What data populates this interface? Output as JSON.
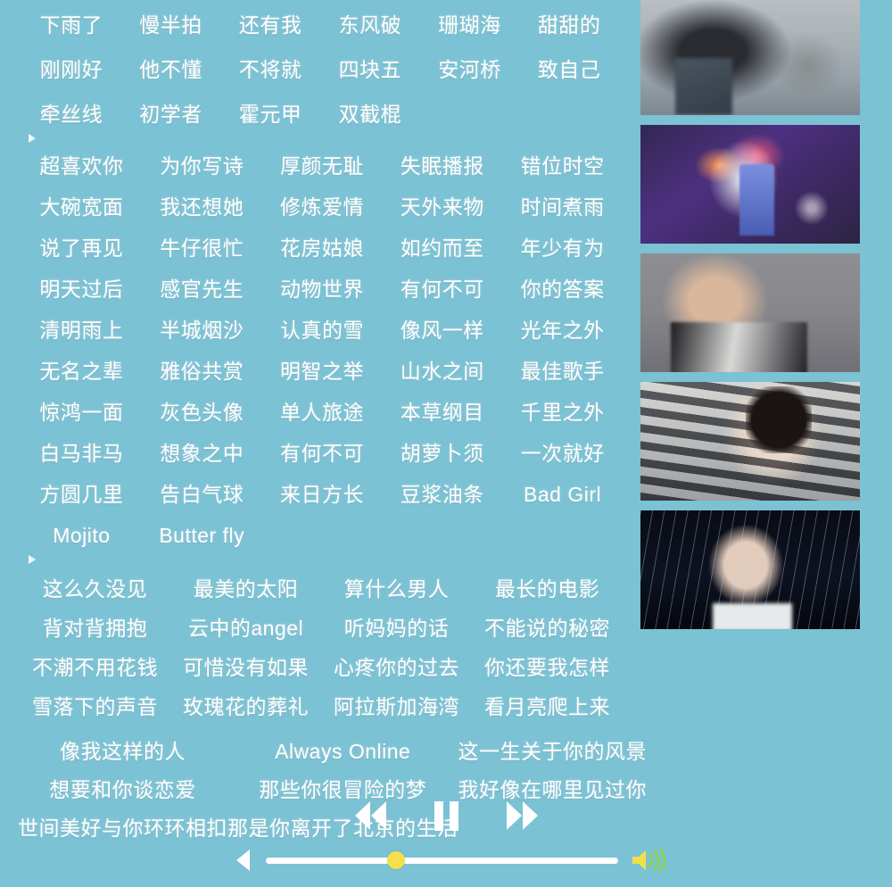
{
  "theme": {
    "background": "#7ac2d4",
    "text": "#ffffff",
    "knob": "#f5e04b",
    "volume_icon": "#f2e04a",
    "volume_waves": "#8fd44a"
  },
  "sections": [
    {
      "id": "section-1",
      "columns": 6,
      "has_marker_after": true,
      "songs": [
        "下雨了",
        "慢半拍",
        "还有我",
        "东风破",
        "珊瑚海",
        "甜甜的",
        "刚刚好",
        "他不懂",
        "不将就",
        "四块五",
        "安河桥",
        "致自己",
        "牵丝线",
        "初学者",
        "霍元甲",
        "双截棍",
        "",
        ""
      ]
    },
    {
      "id": "section-2",
      "columns": 5,
      "has_marker_after": true,
      "songs": [
        "超喜欢你",
        "为你写诗",
        "厚颜无耻",
        "失眠播报",
        "错位时空",
        "大碗宽面",
        "我还想她",
        "修炼爱情",
        "天外来物",
        "时间煮雨",
        "说了再见",
        "牛仔很忙",
        "花房姑娘",
        "如约而至",
        "年少有为",
        "明天过后",
        "感官先生",
        "动物世界",
        "有何不可",
        "你的答案",
        "清明雨上",
        "半城烟沙",
        "认真的雪",
        "像风一样",
        "光年之外",
        "无名之辈",
        "雅俗共赏",
        "明智之举",
        "山水之间",
        "最佳歌手",
        "惊鸿一面",
        "灰色头像",
        "单人旅途",
        "本草纲目",
        "千里之外",
        "白马非马",
        "想象之中",
        "有何不可",
        "胡萝卜须",
        "一次就好",
        "方圆几里",
        "告白气球",
        "来日方长",
        "豆浆油条",
        "Bad Girl",
        "Mojito",
        "Butter fly",
        "",
        "",
        ""
      ]
    },
    {
      "id": "section-3",
      "columns": 4,
      "has_marker_after": false,
      "songs": [
        "这么久没见",
        "最美的太阳",
        "算什么男人",
        "最长的电影",
        "背对背拥抱",
        "云中的angel",
        "听妈妈的话",
        "不能说的秘密",
        "不潮不用花钱",
        "可惜没有如果",
        "心疼你的过去",
        "你还要我怎样",
        "雪落下的声音",
        "玫瑰花的葬礼",
        "阿拉斯加海湾",
        "看月亮爬上来"
      ]
    },
    {
      "id": "section-4",
      "columns": 3,
      "has_marker_after": false,
      "songs": [
        "像我这样的人",
        "Always Online",
        "这一生关于你的风景",
        "想要和你谈恋爱",
        "那些你很冒险的梦",
        "我好像在哪里见过你",
        "世间美好与你环环相扣",
        "那是你离开了北京的生活",
        ""
      ]
    }
  ],
  "thumbnails": [
    {
      "id": "thumb-1",
      "alt": "city rooftop portrait"
    },
    {
      "id": "thumb-2",
      "alt": "purple concert stage performance"
    },
    {
      "id": "thumb-3",
      "alt": "grey studio portrait"
    },
    {
      "id": "thumb-4",
      "alt": "window blinds shadow portrait"
    },
    {
      "id": "thumb-5",
      "alt": "dark rain portrait"
    }
  ],
  "player": {
    "rewind_label": "Rewind",
    "pause_label": "Pause",
    "forward_label": "Fast forward",
    "previous_label": "Previous",
    "volume_label": "Volume",
    "progress_percent": 37
  }
}
